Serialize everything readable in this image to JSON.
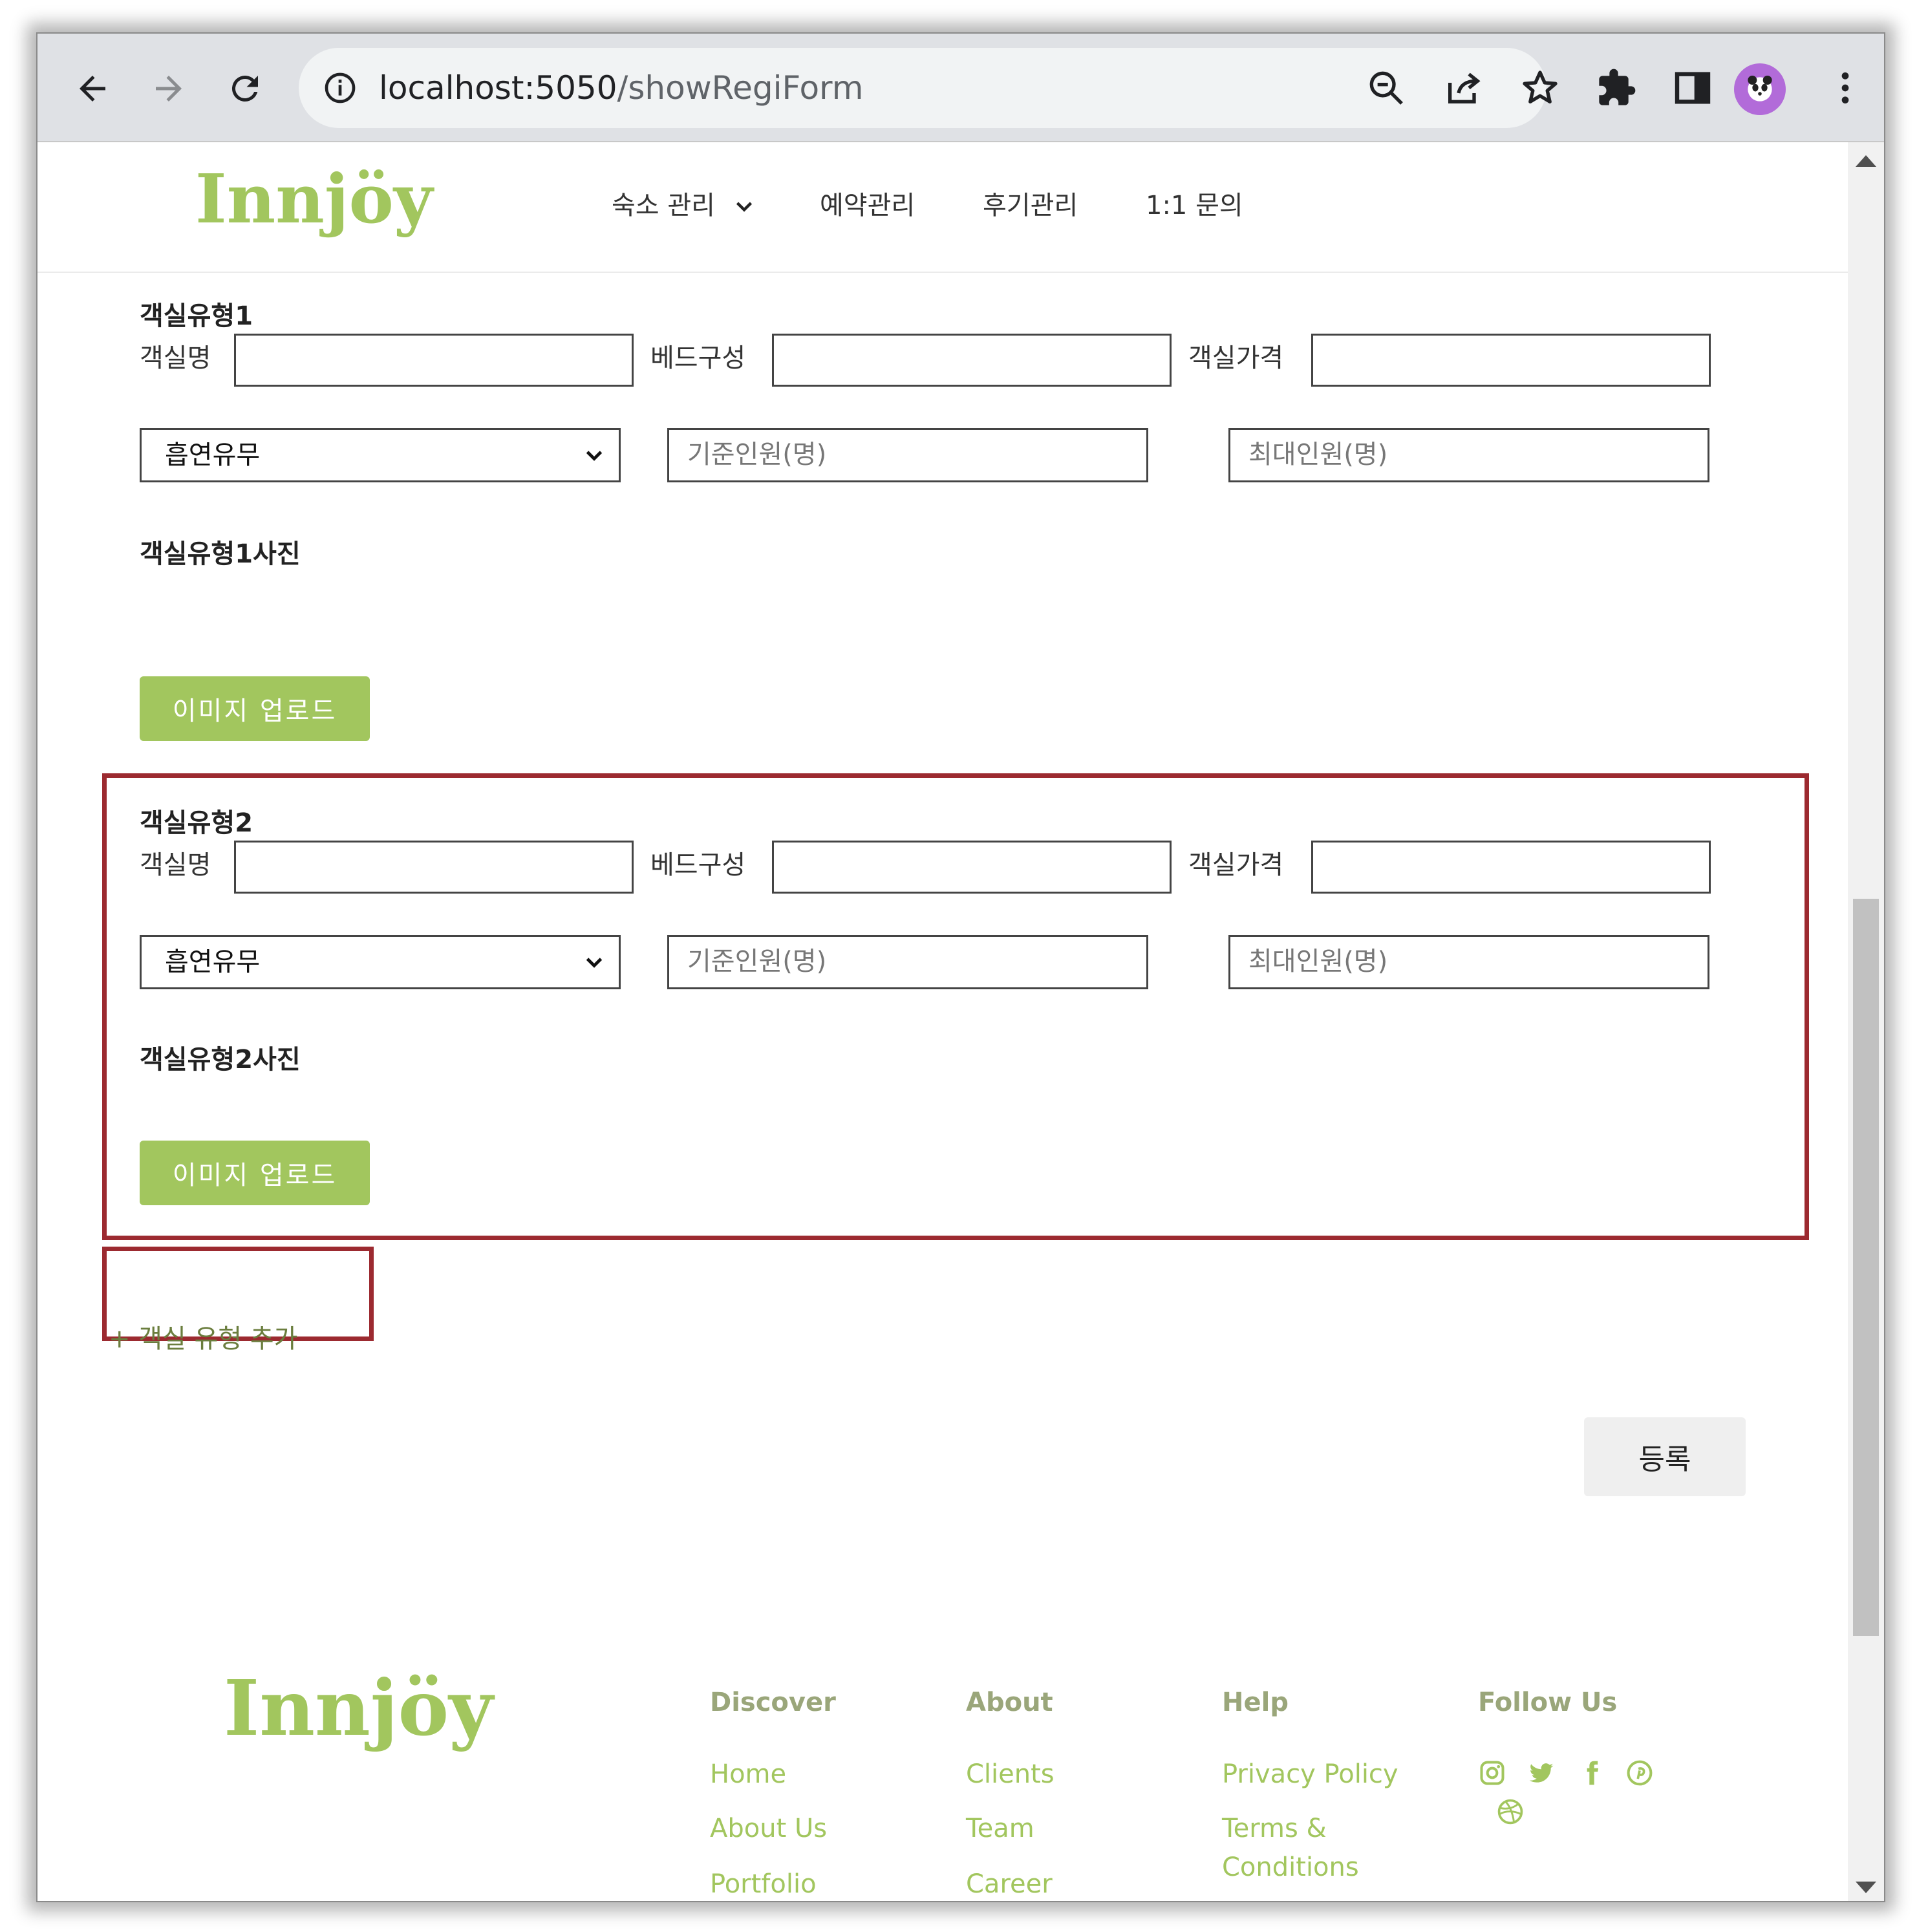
{
  "browser": {
    "url_host": "localhost:5050",
    "url_path": "/showRegiForm"
  },
  "header": {
    "logo": "Innjöy",
    "menu": [
      {
        "label": "숙소 관리"
      },
      {
        "label": "예약관리"
      },
      {
        "label": "후기관리"
      },
      {
        "label": "1:1 문의"
      }
    ]
  },
  "room_types": [
    {
      "title": "객실유형1",
      "name_label": "객실명",
      "bed_label": "베드구성",
      "price_label": "객실가격",
      "smoking_select": "흡연유무",
      "base_placeholder": "기준인원(명)",
      "max_placeholder": "최대인원(명)",
      "photo_title": "객실유형1사진",
      "upload_label": "이미지 업로드"
    },
    {
      "title": "객실유형2",
      "name_label": "객실명",
      "bed_label": "베드구성",
      "price_label": "객실가격",
      "smoking_select": "흡연유무",
      "base_placeholder": "기준인원(명)",
      "max_placeholder": "최대인원(명)",
      "photo_title": "객실유형2사진",
      "upload_label": "이미지 업로드"
    }
  ],
  "add_room_type": "+ 객실 유형 추가",
  "submit_label": "등록",
  "footer": {
    "logo": "Innjöy",
    "columns": [
      {
        "heading": "Discover",
        "links": [
          "Home",
          "About Us",
          "Portfolio"
        ]
      },
      {
        "heading": "About",
        "links": [
          "Clients",
          "Team",
          "Career"
        ]
      },
      {
        "heading": "Help",
        "links": [
          "Privacy Policy",
          "Terms & Conditions"
        ]
      },
      {
        "heading": "Follow Us",
        "icons": [
          "instagram-icon",
          "twitter-icon",
          "facebook-icon",
          "pinterest-icon",
          "dribbble-icon"
        ]
      }
    ]
  },
  "colors": {
    "brand_green": "#a2c65e",
    "highlight_red": "#9c2a30"
  }
}
